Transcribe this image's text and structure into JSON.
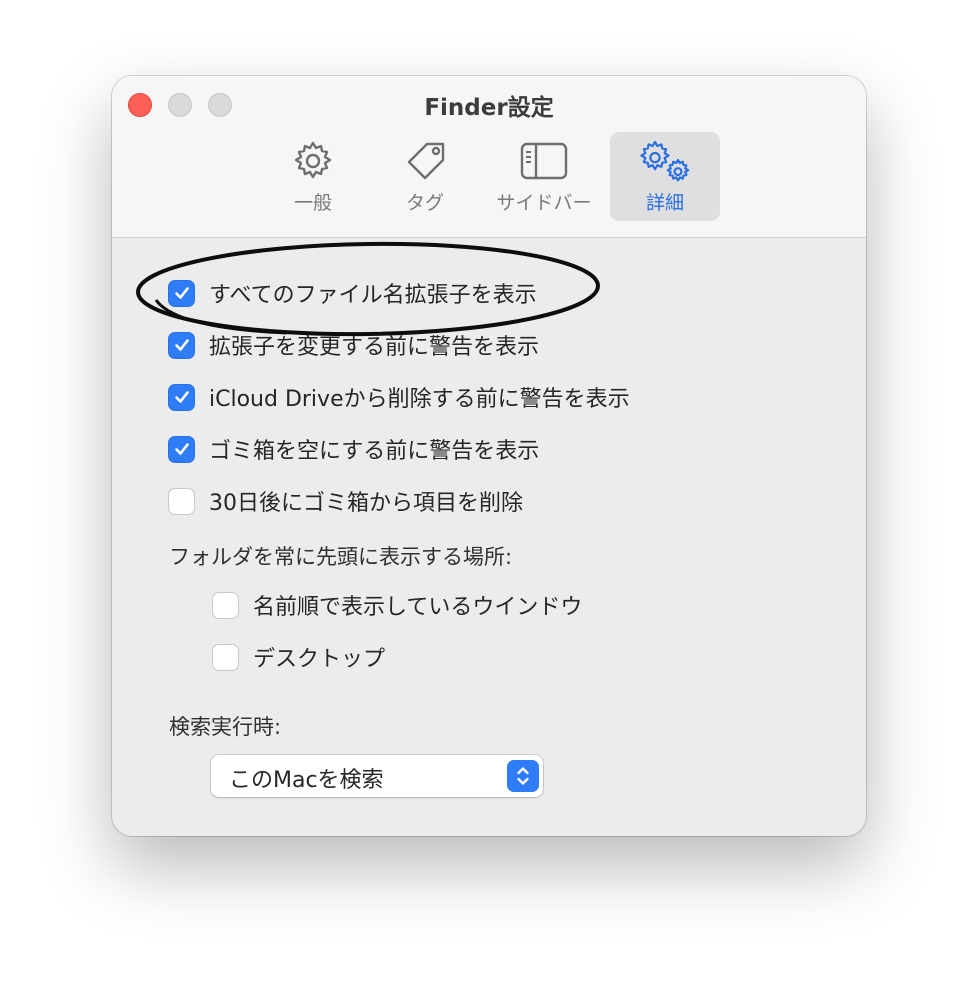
{
  "window": {
    "title": "Finder設定"
  },
  "toolbar": {
    "tabs": [
      {
        "label": "一般",
        "icon": "gear-icon",
        "selected": false
      },
      {
        "label": "タグ",
        "icon": "tag-icon",
        "selected": false
      },
      {
        "label": "サイドバー",
        "icon": "sidebar-icon",
        "selected": false
      },
      {
        "label": "詳細",
        "icon": "gears-icon",
        "selected": true
      }
    ]
  },
  "options": {
    "show_extensions": {
      "label": "すべてのファイル名拡張子を表示",
      "checked": true
    },
    "warn_extension_change": {
      "label": "拡張子を変更する前に警告を表示",
      "checked": true
    },
    "warn_icloud_remove": {
      "label": "iCloud Driveから削除する前に警告を表示",
      "checked": true
    },
    "warn_empty_trash": {
      "label": "ゴミ箱を空にする前に警告を表示",
      "checked": true
    },
    "remove_trash_30days": {
      "label": "30日後にゴミ箱から項目を削除",
      "checked": false
    }
  },
  "folders_on_top": {
    "heading": "フォルダを常に先頭に表示する場所:",
    "sort_by_name_windows": {
      "label": "名前順で表示しているウインドウ",
      "checked": false
    },
    "desktop": {
      "label": "デスクトップ",
      "checked": false
    }
  },
  "search": {
    "heading": "検索実行時:",
    "scope_value": "このMacを検索"
  },
  "colors": {
    "accent": "#2f7df6",
    "close": "#fe5f57",
    "window_bg": "#ececee"
  }
}
